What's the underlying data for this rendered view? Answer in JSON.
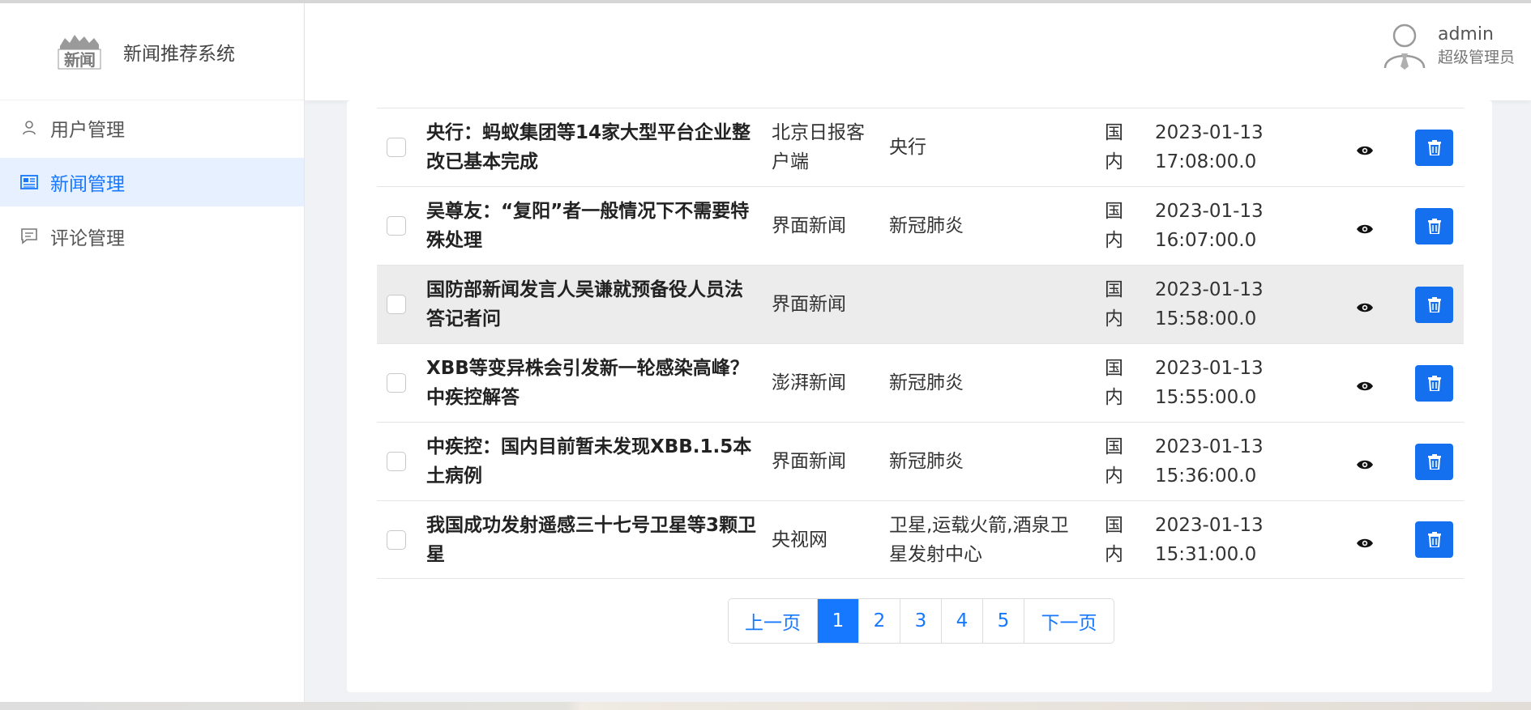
{
  "app": {
    "logo_text": "新闻",
    "title": "新闻推荐系统"
  },
  "sidebar": {
    "items": [
      {
        "label": "用户管理",
        "icon": "user-icon",
        "active": false
      },
      {
        "label": "新闻管理",
        "icon": "newspaper-icon",
        "active": true
      },
      {
        "label": "评论管理",
        "icon": "comment-icon",
        "active": false
      }
    ]
  },
  "user": {
    "name": "admin",
    "role": "超级管理员",
    "avatar_icon": "user-avatar-icon"
  },
  "news": {
    "rows": [
      {
        "title": "央行：蚂蚁集团等14家大型平台企业整改已基本完成",
        "source": "北京日报客户端",
        "tags": "央行",
        "region": "国内",
        "time": "2023-01-13 17:08:00.0"
      },
      {
        "title": "吴尊友：“复阳”者一般情况下不需要特殊处理",
        "source": "界面新闻",
        "tags": "新冠肺炎",
        "region": "国内",
        "time": "2023-01-13 16:07:00.0"
      },
      {
        "title": "国防部新闻发言人吴谦就预备役人员法答记者问",
        "source": "界面新闻",
        "tags": "",
        "region": "国内",
        "time": "2023-01-13 15:58:00.0"
      },
      {
        "title": "XBB等变异株会引发新一轮感染高峰？中疾控解答",
        "source": "澎湃新闻",
        "tags": "新冠肺炎",
        "region": "国内",
        "time": "2023-01-13 15:55:00.0"
      },
      {
        "title": "中疾控：国内目前暂未发现XBB.1.5本土病例",
        "source": "界面新闻",
        "tags": "新冠肺炎",
        "region": "国内",
        "time": "2023-01-13 15:36:00.0"
      },
      {
        "title": "我国成功发射遥感三十七号卫星等3颗卫星",
        "source": "央视网",
        "tags": "卫星,运载火箭,酒泉卫星发射中心",
        "region": "国内",
        "time": "2023-01-13 15:31:00.0"
      }
    ]
  },
  "pagination": {
    "prev": "上一页",
    "next": "下一页",
    "pages": [
      "1",
      "2",
      "3",
      "4",
      "5"
    ],
    "current": "1"
  },
  "colors": {
    "accent": "#1677ff",
    "delete_button": "#1570ef",
    "highlight_row": "#ececec"
  }
}
